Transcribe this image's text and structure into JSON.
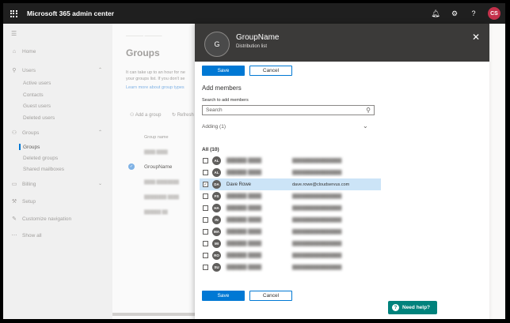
{
  "topbar": {
    "app_title": "Microsoft 365 admin center",
    "user_initials": "CS"
  },
  "leftnav": {
    "items": [
      {
        "label": "Home",
        "icon": "home-icon"
      },
      {
        "label": "Users",
        "icon": "user-icon"
      },
      {
        "label": "Groups",
        "icon": "groups-icon"
      },
      {
        "label": "Billing",
        "icon": "billing-icon"
      },
      {
        "label": "Setup",
        "icon": "setup-icon"
      },
      {
        "label": "Customize navigation",
        "icon": "pencil-icon"
      },
      {
        "label": "Show all",
        "icon": "ellipsis-icon"
      }
    ],
    "users_sub": [
      "Active users",
      "Contacts",
      "Guest users",
      "Deleted users"
    ],
    "groups_sub": [
      "Groups",
      "Deleted groups",
      "Shared mailboxes"
    ]
  },
  "main": {
    "title": "Groups",
    "desc_line1": "It can take up to an hour for ne",
    "desc_line2": "your groups list. If you don't se",
    "link": "Learn more about group types",
    "add_group": "Add a group",
    "refresh": "Refresh",
    "col_group_name": "Group name",
    "selected_group": "GroupName"
  },
  "panel": {
    "avatar_letter": "G",
    "group_name": "GroupName",
    "group_type": "Distribution list",
    "save_label": "Save",
    "cancel_label": "Cancel",
    "section_title": "Add members",
    "search_label": "Search to add members",
    "search_placeholder": "Search",
    "adding_label": "Adding (1)",
    "all_label": "All (10)",
    "members": [
      {
        "initials": "AL",
        "name": "",
        "email": "",
        "checked": false
      },
      {
        "initials": "AL",
        "name": "",
        "email": "",
        "checked": false
      },
      {
        "initials": "DA",
        "name": "Dave Rowe",
        "email": "dave.rowe@cloudservus.com",
        "checked": true
      },
      {
        "initials": "FS",
        "name": "",
        "email": "",
        "checked": false
      },
      {
        "initials": "HA",
        "name": "",
        "email": "",
        "checked": false
      },
      {
        "initials": "IN",
        "name": "",
        "email": "",
        "checked": false
      },
      {
        "initials": "MA",
        "name": "",
        "email": "",
        "checked": false
      },
      {
        "initials": "MI",
        "name": "",
        "email": "",
        "checked": false
      },
      {
        "initials": "RO",
        "name": "",
        "email": "",
        "checked": false
      },
      {
        "initials": "SU",
        "name": "",
        "email": "",
        "checked": false
      }
    ]
  },
  "help": {
    "label": "Need help?"
  },
  "colors": {
    "accent": "#0078d4",
    "help": "#00827c",
    "selected_row": "#cce4f7",
    "user_avatar": "#c4314b"
  }
}
